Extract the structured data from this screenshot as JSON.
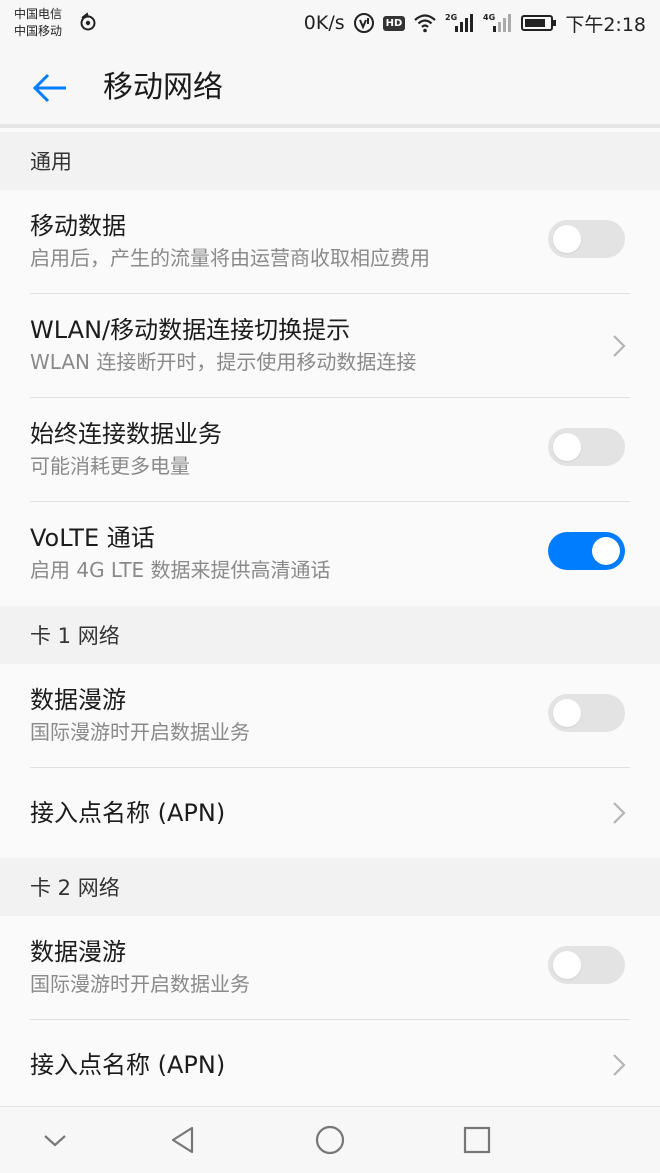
{
  "status_bar": {
    "carrier_1": "中国电信",
    "carrier_2": "中国移动",
    "speed": "0K/s",
    "hd": "HD",
    "signal_2g": "2G",
    "signal_4g": "4G",
    "time": "下午2:18"
  },
  "header": {
    "title": "移动网络"
  },
  "sections": {
    "general": {
      "label": "通用",
      "mobile_data": {
        "title": "移动数据",
        "subtitle": "启用后，产生的流量将由运营商收取相应费用",
        "enabled": false
      },
      "wlan_switch": {
        "title": "WLAN/移动数据连接切换提示",
        "subtitle": "WLAN 连接断开时，提示使用移动数据连接"
      },
      "always_on": {
        "title": "始终连接数据业务",
        "subtitle": "可能消耗更多电量",
        "enabled": false
      },
      "volte": {
        "title": "VoLTE 通话",
        "subtitle": "启用 4G LTE 数据来提供高清通话",
        "enabled": true
      }
    },
    "card1": {
      "label": "卡 1 网络",
      "roaming": {
        "title": "数据漫游",
        "subtitle": "国际漫游时开启数据业务",
        "enabled": false
      },
      "apn": {
        "title": "接入点名称 (APN)"
      }
    },
    "card2": {
      "label": "卡 2 网络",
      "roaming": {
        "title": "数据漫游",
        "subtitle": "国际漫游时开启数据业务",
        "enabled": false
      },
      "apn": {
        "title": "接入点名称 (APN)"
      }
    }
  },
  "colors": {
    "accent": "#007dff",
    "toggle_off": "#e3e3e3"
  },
  "icons": [
    "network-activity-icon",
    "volte-icon",
    "hd-icon",
    "wifi-icon",
    "signal-icon",
    "battery-icon",
    "back-arrow-icon",
    "chevron-right-icon",
    "nav-down-icon",
    "nav-back-icon",
    "nav-home-icon",
    "nav-recents-icon"
  ]
}
